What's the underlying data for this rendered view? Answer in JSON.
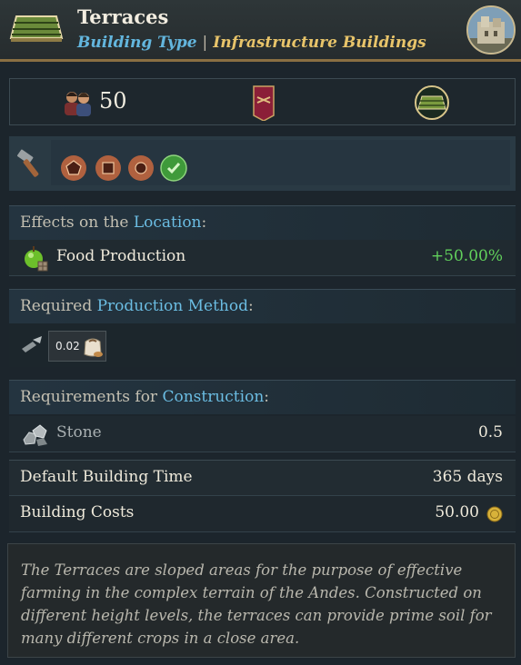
{
  "header": {
    "title": "Terraces",
    "type_label": "Building Type",
    "separator": "|",
    "category": "Infrastructure Buildings"
  },
  "summary": {
    "population": "50"
  },
  "effects": {
    "heading_prefix": "Effects on the ",
    "heading_link": "Location",
    "heading_suffix": ":",
    "items": [
      {
        "label": "Food Production",
        "value": "+50.00%"
      }
    ]
  },
  "production_method": {
    "heading_prefix": "Required ",
    "heading_link": "Production Method",
    "heading_suffix": ":",
    "goods_amount": "0.02"
  },
  "requirements": {
    "heading_prefix": "Requirements for ",
    "heading_link": "Construction",
    "heading_suffix": ":",
    "items": [
      {
        "label": "Stone",
        "value": "0.5"
      }
    ]
  },
  "stats": {
    "build_time_label": "Default Building Time",
    "build_time_value": "365 days",
    "cost_label": "Building Costs",
    "cost_value": "50.00"
  },
  "description": "The Terraces are sloped areas for the purpose of effective farming in the complex terrain of the Andes. Constructed on different height levels, the terraces can provide prime soil for many different crops in a close area.",
  "colors": {
    "accent_blue": "#63b6de",
    "accent_gold": "#e8c46a",
    "positive_green": "#62d15c",
    "frame_bronze": "#8a6f42"
  },
  "icons": [
    "terrace-icon",
    "portrait-icon",
    "population-icon",
    "banner-icon",
    "terrace-badge-icon",
    "hammer-icon",
    "pentagon-icon",
    "square-icon",
    "circle-icon",
    "check-icon",
    "apple-icon",
    "tool-icon",
    "flour-icon",
    "stone-icon",
    "coin-icon"
  ]
}
